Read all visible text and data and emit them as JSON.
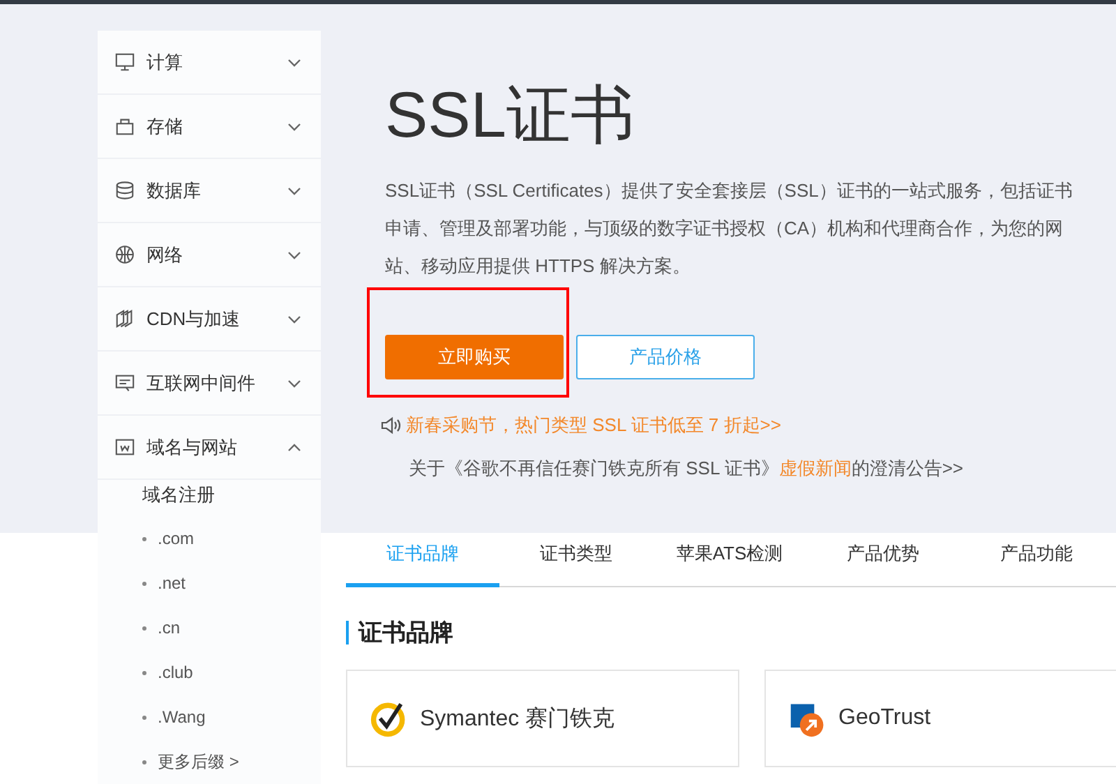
{
  "sidebar": {
    "items": [
      {
        "label": "计算",
        "expanded": false
      },
      {
        "label": "存储",
        "expanded": false
      },
      {
        "label": "数据库",
        "expanded": false
      },
      {
        "label": "网络",
        "expanded": false
      },
      {
        "label": "CDN与加速",
        "expanded": false
      },
      {
        "label": "互联网中间件",
        "expanded": false
      },
      {
        "label": "域名与网站",
        "expanded": true,
        "children": [
          {
            "label": "域名注册",
            "children": [
              {
                "label": ".com"
              },
              {
                "label": ".net"
              },
              {
                "label": ".cn"
              },
              {
                "label": ".club"
              },
              {
                "label": ".Wang"
              },
              {
                "label": "更多后缀 >"
              }
            ]
          }
        ]
      }
    ]
  },
  "hero": {
    "title": "SSL证书",
    "description": "SSL证书（SSL Certificates）提供了安全套接层（SSL）证书的一站式服务，包括证书申请、管理及部署功能，与顶级的数字证书授权（CA）机构和代理商合作，为您的网站、移动应用提供 HTTPS 解决方案。",
    "buttons": [
      {
        "label": "立即购买",
        "kind": "primary"
      },
      {
        "label": "产品价格",
        "kind": "outline"
      }
    ],
    "promo": "新春采购节，热门类型 SSL 证书低至 7 折起>>",
    "notice": {
      "before": "关于《谷歌不再信任赛门铁克所有 SSL 证书》",
      "highlight": "虚假新闻",
      "after": "的澄清公告>>"
    }
  },
  "tabs": [
    {
      "label": "证书品牌",
      "selected": true
    },
    {
      "label": "证书类型",
      "selected": false
    },
    {
      "label": "苹果ATS检测",
      "selected": false
    },
    {
      "label": "产品优势",
      "selected": false
    },
    {
      "label": "产品功能",
      "selected": false
    }
  ],
  "section": {
    "title": "证书品牌",
    "brands": [
      {
        "name": "Symantec 赛门铁克"
      },
      {
        "name": "GeoTrust"
      }
    ]
  }
}
